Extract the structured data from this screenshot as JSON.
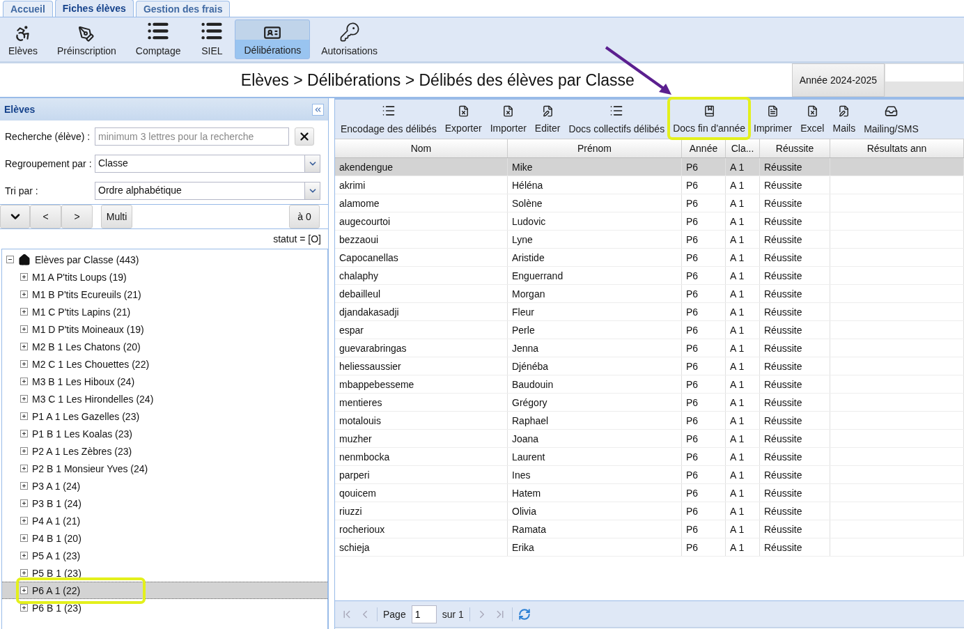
{
  "tabs": [
    {
      "label": "Accueil",
      "selected": false
    },
    {
      "label": "Fiches élèves",
      "selected": true
    },
    {
      "label": "Gestion des frais",
      "selected": false
    }
  ],
  "ribbon": [
    {
      "label": "Elèves",
      "kind": "student",
      "selected": false
    },
    {
      "label": "Préinscription",
      "kind": "pen",
      "selected": false
    },
    {
      "label": "Comptage",
      "kind": "list",
      "selected": false
    },
    {
      "label": "SIEL",
      "kind": "list",
      "selected": false
    },
    {
      "label": "Délibérations",
      "kind": "card",
      "selected": true
    },
    {
      "label": "Autorisations",
      "kind": "key",
      "selected": false
    }
  ],
  "breadcrumb": "Elèves > Délibérations > Délibés des élèves par Classe",
  "year_button": "Année 2024-2025",
  "annotation_arrow": true,
  "left_panel": {
    "title": "Elèves",
    "search": {
      "label": "Recherche (élève) :",
      "placeholder": "minimum 3 lettres pour la recherche"
    },
    "group_by": {
      "label": "Regroupement par :",
      "value": "Classe"
    },
    "sort_by": {
      "label": "Tri par :",
      "value": "Ordre alphabétique"
    },
    "nav_buttons": [
      {
        "label": "<"
      },
      {
        "label": ">"
      }
    ],
    "multi_button": "Multi",
    "reset_button": "à 0",
    "status": "statut = [O]",
    "tree": {
      "label": "Elèves par Classe (443)",
      "expanded": true,
      "children": [
        {
          "label": "M1 A P'tits Loups (19)",
          "selected": false,
          "highlighted": false
        },
        {
          "label": "M1 B P'tits Ecureuils (21)",
          "selected": false,
          "highlighted": false
        },
        {
          "label": "M1 C P'tits Lapins (21)",
          "selected": false,
          "highlighted": false
        },
        {
          "label": "M1 D P'tits Moineaux (19)",
          "selected": false,
          "highlighted": false
        },
        {
          "label": "M2 B 1 Les Chatons (20)",
          "selected": false,
          "highlighted": false
        },
        {
          "label": "M2 C 1 Les Chouettes (22)",
          "selected": false,
          "highlighted": false
        },
        {
          "label": "M3 B 1 Les Hiboux (24)",
          "selected": false,
          "highlighted": false
        },
        {
          "label": "M3 C 1 Les Hirondelles (24)",
          "selected": false,
          "highlighted": false
        },
        {
          "label": "P1 A 1 Les Gazelles (23)",
          "selected": false,
          "highlighted": false
        },
        {
          "label": "P1 B 1 Les Koalas (23)",
          "selected": false,
          "highlighted": false
        },
        {
          "label": "P2 A 1 Les Zèbres (23)",
          "selected": false,
          "highlighted": false
        },
        {
          "label": "P2 B 1 Monsieur Yves (24)",
          "selected": false,
          "highlighted": false
        },
        {
          "label": "P3 A 1 (24)",
          "selected": false,
          "highlighted": false
        },
        {
          "label": "P3 B 1 (24)",
          "selected": false,
          "highlighted": false
        },
        {
          "label": "P4 A 1 (21)",
          "selected": false,
          "highlighted": false
        },
        {
          "label": "P4 B 1 (20)",
          "selected": false,
          "highlighted": false
        },
        {
          "label": "P5 A 1 (23)",
          "selected": false,
          "highlighted": false
        },
        {
          "label": "P5 B 1 (23)",
          "selected": false,
          "highlighted": false
        },
        {
          "label": "P6 A 1 (22)",
          "selected": true,
          "highlighted": true
        },
        {
          "label": "P6 B 1 (23)",
          "selected": false,
          "highlighted": false
        }
      ]
    }
  },
  "grid_toolbar": [
    {
      "label": "Encodage des délibés",
      "kind": "list",
      "highlighted": false
    },
    {
      "label": "Exporter",
      "kind": "filex",
      "highlighted": false
    },
    {
      "label": "Importer",
      "kind": "filex",
      "highlighted": false
    },
    {
      "label": "Editer",
      "kind": "edit",
      "highlighted": false
    },
    {
      "label": "Docs collectifs délibés",
      "kind": "list",
      "highlighted": false
    },
    {
      "label": "Docs fin d'année",
      "kind": "book",
      "highlighted": true
    },
    {
      "label": "Imprimer",
      "kind": "file",
      "highlighted": false
    },
    {
      "label": "Excel",
      "kind": "filex",
      "highlighted": false
    },
    {
      "label": "Mails",
      "kind": "edit",
      "highlighted": false
    },
    {
      "label": "Mailing/SMS",
      "kind": "inbox",
      "highlighted": false
    }
  ],
  "grid": {
    "columns": [
      "Nom",
      "Prénom",
      "Année",
      "Cla...",
      "Réussite",
      "Résultats ann"
    ],
    "rows": [
      {
        "cells": [
          "akendengue",
          "Mike",
          "P6",
          "A 1",
          "Réussite"
        ],
        "selected": true
      },
      {
        "cells": [
          "akrimi",
          "Héléna",
          "P6",
          "A 1",
          "Réussite"
        ],
        "selected": false
      },
      {
        "cells": [
          "alamome",
          "Solène",
          "P6",
          "A 1",
          "Réussite"
        ],
        "selected": false
      },
      {
        "cells": [
          "augecourtoi",
          "Ludovic",
          "P6",
          "A 1",
          "Réussite"
        ],
        "selected": false
      },
      {
        "cells": [
          "bezzaoui",
          "Lyne",
          "P6",
          "A 1",
          "Réussite"
        ],
        "selected": false
      },
      {
        "cells": [
          "Capocanellas",
          "Aristide",
          "P6",
          "A 1",
          "Réussite"
        ],
        "selected": false
      },
      {
        "cells": [
          "chalaphy",
          "Enguerrand",
          "P6",
          "A 1",
          "Réussite"
        ],
        "selected": false
      },
      {
        "cells": [
          "debailleul",
          "Morgan",
          "P6",
          "A 1",
          "Réussite"
        ],
        "selected": false
      },
      {
        "cells": [
          "djandakasadji",
          "Fleur",
          "P6",
          "A 1",
          "Réussite"
        ],
        "selected": false
      },
      {
        "cells": [
          "espar",
          "Perle",
          "P6",
          "A 1",
          "Réussite"
        ],
        "selected": false
      },
      {
        "cells": [
          "guevarabringas",
          "Jenna",
          "P6",
          "A 1",
          "Réussite"
        ],
        "selected": false
      },
      {
        "cells": [
          "heliessaussier",
          "Djénéba",
          "P6",
          "A 1",
          "Réussite"
        ],
        "selected": false
      },
      {
        "cells": [
          "mbappebesseme",
          "Baudouin",
          "P6",
          "A 1",
          "Réussite"
        ],
        "selected": false
      },
      {
        "cells": [
          "mentieres",
          "Grégory",
          "P6",
          "A 1",
          "Réussite"
        ],
        "selected": false
      },
      {
        "cells": [
          "motalouis",
          "Raphael",
          "P6",
          "A 1",
          "Réussite"
        ],
        "selected": false
      },
      {
        "cells": [
          "muzher",
          "Joana",
          "P6",
          "A 1",
          "Réussite"
        ],
        "selected": false
      },
      {
        "cells": [
          "nenmbocka",
          "Laurent",
          "P6",
          "A 1",
          "Réussite"
        ],
        "selected": false
      },
      {
        "cells": [
          "parperi",
          "Ines",
          "P6",
          "A 1",
          "Réussite"
        ],
        "selected": false
      },
      {
        "cells": [
          "qouicem",
          "Hatem",
          "P6",
          "A 1",
          "Réussite"
        ],
        "selected": false
      },
      {
        "cells": [
          "riuzzi",
          "Olivia",
          "P6",
          "A 1",
          "Réussite"
        ],
        "selected": false
      },
      {
        "cells": [
          "rocherioux",
          "Ramata",
          "P6",
          "A 1",
          "Réussite"
        ],
        "selected": false
      },
      {
        "cells": [
          "schieja",
          "Erika",
          "P6",
          "A 1",
          "Réussite"
        ],
        "selected": false
      }
    ]
  },
  "pager": {
    "page_label": "Page",
    "page": "1",
    "total": "sur 1"
  }
}
